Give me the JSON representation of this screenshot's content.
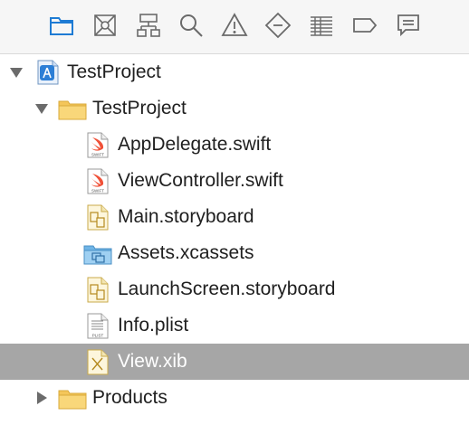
{
  "toolbar": {
    "buttons": [
      {
        "name": "project-navigator-icon",
        "active": true
      },
      {
        "name": "source-control-navigator-icon"
      },
      {
        "name": "symbol-navigator-icon"
      },
      {
        "name": "find-navigator-icon"
      },
      {
        "name": "issue-navigator-icon"
      },
      {
        "name": "test-navigator-icon"
      },
      {
        "name": "debug-navigator-icon"
      },
      {
        "name": "breakpoint-navigator-icon"
      },
      {
        "name": "report-navigator-icon"
      }
    ]
  },
  "colors": {
    "accent": "#1e7bd4",
    "toolbar_icon": "#6a6a6a",
    "selection": "#a6a6a6",
    "folder": "#f4c65a",
    "swift": "#f05138"
  },
  "tree": {
    "project": {
      "label": "TestProject",
      "expanded": true,
      "icon": "xcode-project-icon"
    },
    "group": {
      "label": "TestProject",
      "expanded": true,
      "icon": "folder-icon"
    },
    "files": [
      {
        "label": "AppDelegate.swift",
        "icon": "swift-file-icon",
        "badge": "SWIFT"
      },
      {
        "label": "ViewController.swift",
        "icon": "swift-file-icon",
        "badge": "SWIFT"
      },
      {
        "label": "Main.storyboard",
        "icon": "storyboard-file-icon"
      },
      {
        "label": "Assets.xcassets",
        "icon": "asset-catalog-icon"
      },
      {
        "label": "LaunchScreen.storyboard",
        "icon": "storyboard-file-icon"
      },
      {
        "label": "Info.plist",
        "icon": "plist-file-icon",
        "badge": "PLIST"
      },
      {
        "label": "View.xib",
        "icon": "xib-file-icon",
        "selected": true
      }
    ],
    "products": {
      "label": "Products",
      "expanded": false,
      "icon": "folder-icon"
    }
  }
}
